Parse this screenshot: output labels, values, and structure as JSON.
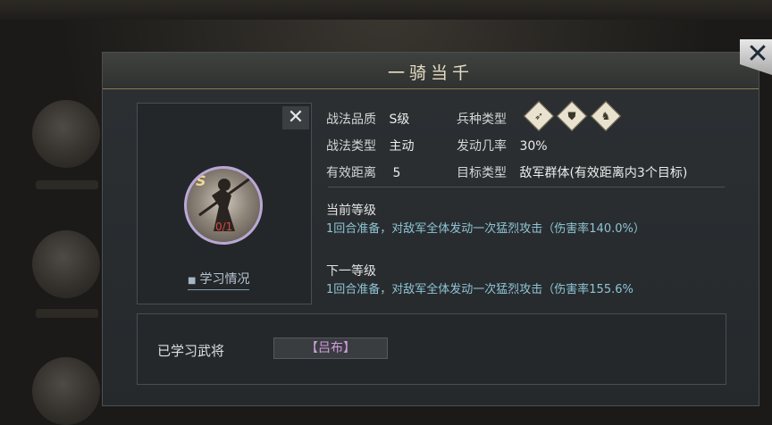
{
  "dialog": {
    "title": "一骑当千",
    "close_glyph": "✕"
  },
  "skill": {
    "grade_badge": "S",
    "learn_progress": "0/1",
    "close_glyph": "✕",
    "learn_link": "学习情况",
    "icon": "warrior-portrait-icon"
  },
  "info": {
    "quality_label": "战法品质",
    "quality_value": "S级",
    "troop_label": "兵种类型",
    "troop_icons": [
      "bow-icon",
      "shield-icon",
      "horse-icon"
    ],
    "type_label": "战法类型",
    "type_value": "主动",
    "rate_label": "发动几率",
    "rate_value": "30%",
    "range_label": "有效距离",
    "range_value": "5",
    "target_label": "目标类型",
    "target_value": "敌军群体(有效距离内3个目标)"
  },
  "levels": {
    "current_label": "当前等级",
    "current_desc": "1回合准备，对敌军全体发动一次猛烈攻击（伤害率140.0%）",
    "next_label": "下一等级",
    "next_desc": "1回合准备，对敌军全体发动一次猛烈攻击（伤害率155.6%"
  },
  "learned": {
    "label": "已学习武将",
    "general": "【吕布】"
  }
}
